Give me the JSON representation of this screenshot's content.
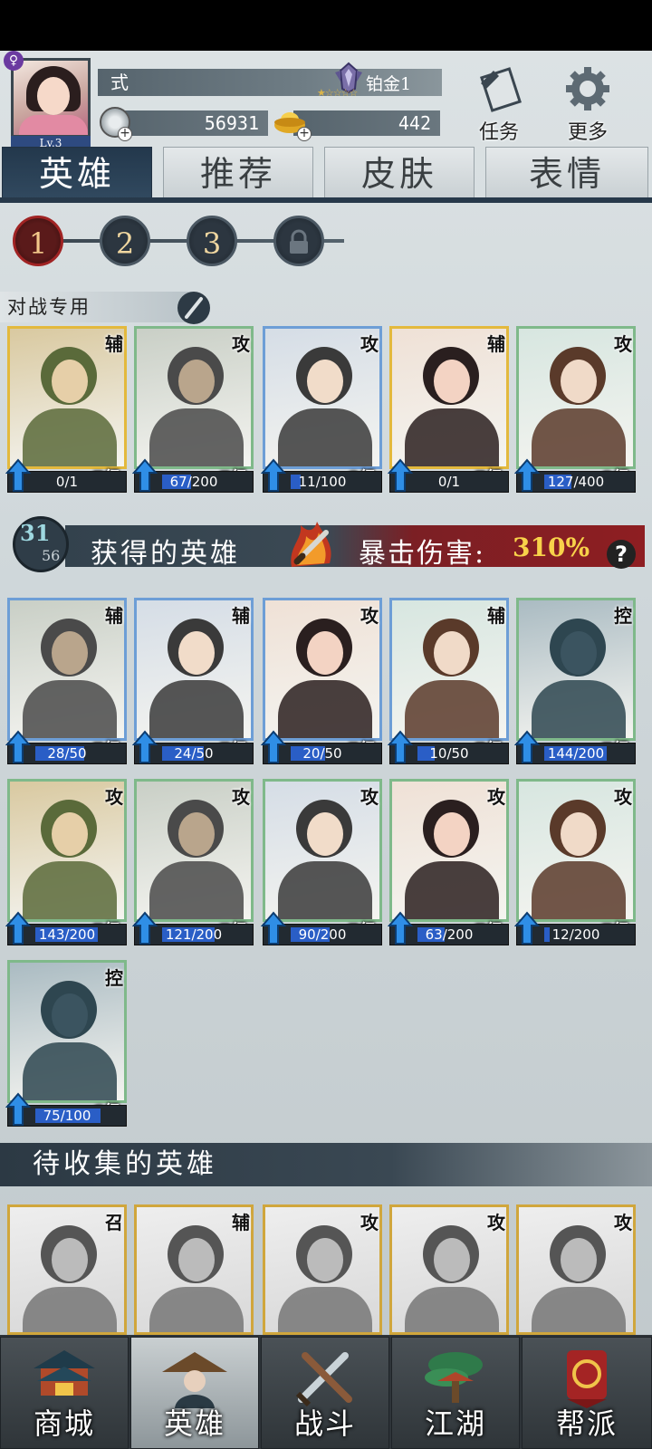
{
  "player": {
    "name": "式",
    "level_label": "Lv.3",
    "rank": "铂金1",
    "silver": "56931",
    "gold": "442",
    "gender_symbol": "♀"
  },
  "top_buttons": {
    "tasks": "任务",
    "more": "更多"
  },
  "tabs": [
    "英雄",
    "推荐",
    "皮肤",
    "表情"
  ],
  "active_tab": "英雄",
  "pages": [
    "1",
    "2",
    "3"
  ],
  "active_page": "1",
  "battle_section": {
    "label": "对战专用"
  },
  "battle_heroes": [
    {
      "role": "辅",
      "level": "7级",
      "progress": "0/1",
      "fraction": 0,
      "frame": "gold"
    },
    {
      "role": "攻",
      "level": "7级",
      "progress": "67/200",
      "fraction": 0.335,
      "frame": "green"
    },
    {
      "role": "攻",
      "level": "8级",
      "progress": "11/100",
      "fraction": 0.11,
      "frame": "blue"
    },
    {
      "role": "辅",
      "level": "7级",
      "progress": "0/1",
      "fraction": 0,
      "frame": "gold"
    },
    {
      "role": "攻",
      "level": "8级",
      "progress": "127/400",
      "fraction": 0.3175,
      "frame": "green"
    }
  ],
  "collected": {
    "owned": "31",
    "total": "56",
    "title": "获得的英雄",
    "bonus_label": "暴击伤害:",
    "bonus_value": "310%",
    "help": "?"
  },
  "collected_heroes": [
    {
      "role": "辅",
      "level": "7级",
      "progress": "28/50",
      "fraction": 0.56,
      "frame": "blue"
    },
    {
      "role": "辅",
      "level": "7级",
      "progress": "24/50",
      "fraction": 0.48,
      "frame": "blue"
    },
    {
      "role": "攻",
      "level": "7级",
      "progress": "20/50",
      "fraction": 0.4,
      "frame": "blue"
    },
    {
      "role": "辅",
      "level": "7级",
      "progress": "10/50",
      "fraction": 0.2,
      "frame": "blue"
    },
    {
      "role": "控",
      "level": "7级",
      "progress": "144/200",
      "fraction": 0.72,
      "frame": "green"
    },
    {
      "role": "攻",
      "level": "7级",
      "progress": "143/200",
      "fraction": 0.715,
      "frame": "green"
    },
    {
      "role": "攻",
      "level": "7级",
      "progress": "121/200",
      "fraction": 0.605,
      "frame": "green"
    },
    {
      "role": "攻",
      "level": "7级",
      "progress": "90/200",
      "fraction": 0.45,
      "frame": "green"
    },
    {
      "role": "攻",
      "level": "7级",
      "progress": "63/200",
      "fraction": 0.315,
      "frame": "green"
    },
    {
      "role": "攻",
      "level": "7级",
      "progress": "12/200",
      "fraction": 0.06,
      "frame": "green"
    },
    {
      "role": "控",
      "level": "6级",
      "progress": "75/100",
      "fraction": 0.75,
      "frame": "green"
    }
  ],
  "uncollected_title": "待收集的英雄",
  "uncollected_heroes": [
    {
      "role": "召"
    },
    {
      "role": "辅"
    },
    {
      "role": "攻"
    },
    {
      "role": "攻"
    },
    {
      "role": "攻"
    }
  ],
  "nav": [
    "商城",
    "英雄",
    "战斗",
    "江湖",
    "帮派"
  ],
  "active_nav": "英雄",
  "icons": {
    "tasks": "scroll-icon",
    "more": "gear-icon",
    "silver": "silver-coin-icon",
    "gold": "gold-ingot-icon",
    "rank": "platinum-rank-icon",
    "edit": "brush-icon",
    "crit": "flaming-sword-icon",
    "lock": "lock-icon"
  },
  "colors": {
    "accent": "#27394a",
    "crit": "#8e1e22",
    "bonus": "#f8d24a",
    "progress": "#2a5ec6"
  }
}
